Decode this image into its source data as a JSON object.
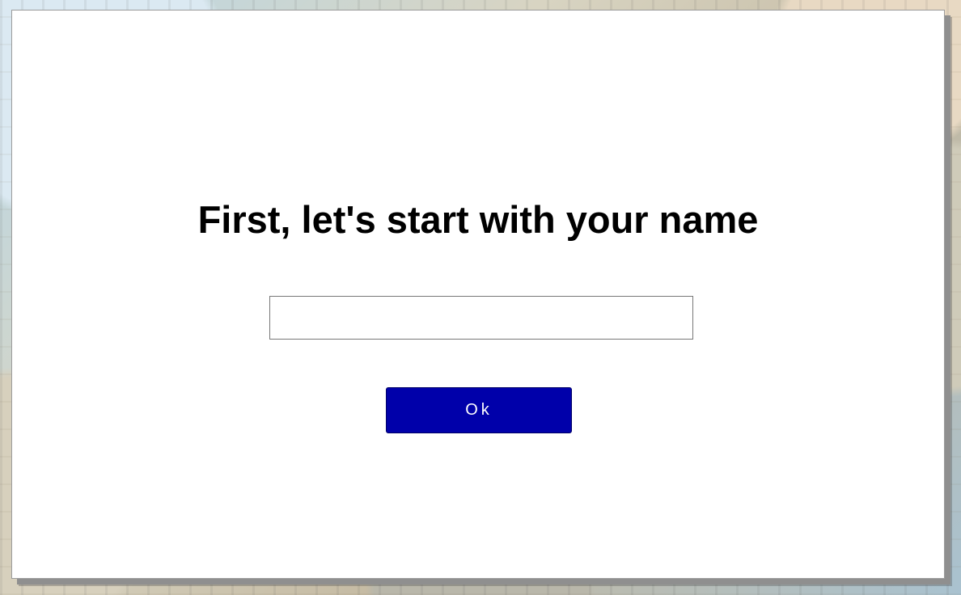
{
  "dialog": {
    "title": "First, let's start with your name",
    "name_input": {
      "value": "",
      "placeholder": ""
    },
    "ok_button_label": "Ok"
  },
  "colors": {
    "dialog_background": "#ffffff",
    "button_background": "#0000aa",
    "button_text": "#ffffff",
    "title_text": "#000000"
  }
}
